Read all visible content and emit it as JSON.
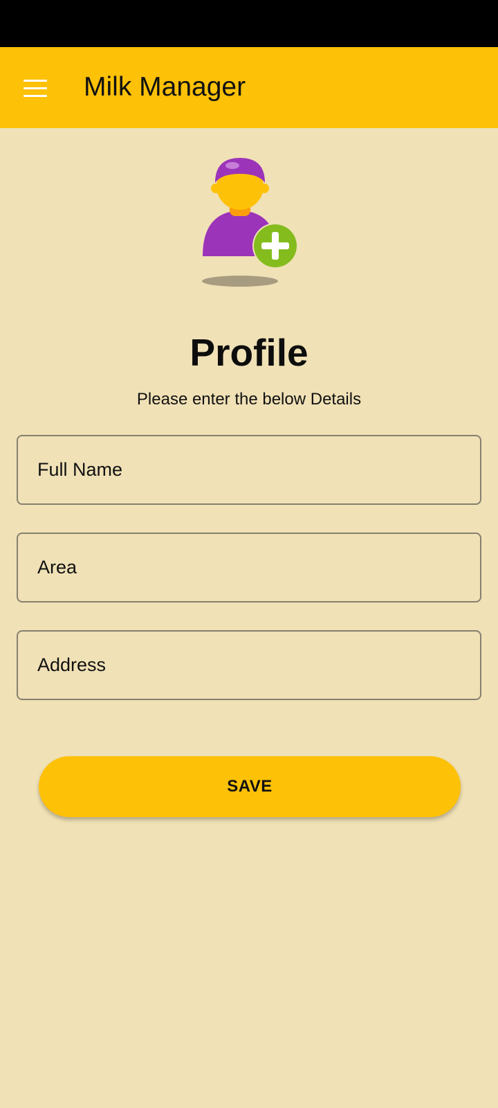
{
  "app_bar": {
    "title": "Milk Manager",
    "menu_icon": "hamburger-menu-icon"
  },
  "avatar": {
    "icon": "add-user-icon"
  },
  "profile": {
    "title": "Profile",
    "subtitle": "Please enter the below Details"
  },
  "form": {
    "full_name": {
      "placeholder": "Full Name",
      "value": ""
    },
    "area": {
      "placeholder": "Area",
      "value": ""
    },
    "address": {
      "placeholder": "Address",
      "value": ""
    },
    "save_label": "SAVE"
  },
  "colors": {
    "background": "#f0e1b6",
    "accent": "#fdc107",
    "status_bar": "#000000",
    "avatar_purple": "#9c34b9",
    "avatar_skin": "#fdc107",
    "plus_green": "#84bc1e"
  }
}
